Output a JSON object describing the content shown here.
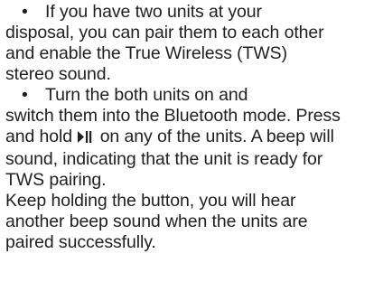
{
  "instructions": {
    "bullet_symbol": "•",
    "item1": {
      "line1": "If you have two units at your",
      "line2": "disposal, you can pair them to each other",
      "line3": "and enable the True Wireless (TWS)",
      "line4": "stereo sound."
    },
    "item2": {
      "line1": "Turn the both units on and",
      "line2": "switch them into the Bluetooth mode. Press",
      "line3_before_icon": "and hold",
      "line3_icon": "play-pause-icon",
      "line3_after_icon": "on any of the units. A beep will",
      "line4": "sound, indicating that the unit is ready for",
      "line5": "TWS pairing."
    },
    "followup": {
      "line1": "Keep holding the button, you will hear",
      "line2": "another beep sound when the units are",
      "line3": "paired successfully."
    }
  }
}
